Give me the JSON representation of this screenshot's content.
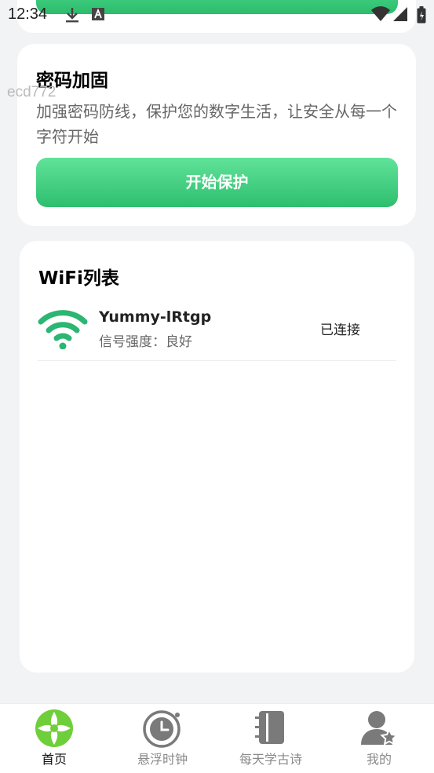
{
  "status_bar": {
    "time": "12:34"
  },
  "password_card": {
    "title": "密码加固",
    "description": "加强密码防线，保护您的数字生活，让安全从每一个字符开始",
    "button_label": "开始保护"
  },
  "watermark": "ecd772",
  "wifi_card": {
    "title": "WiFi列表",
    "items": [
      {
        "name": "Yummy-lRtgp",
        "signal": "信号强度：良好",
        "status": "已连接"
      }
    ]
  },
  "bottom_nav": {
    "items": [
      {
        "label": "首页",
        "icon": "home-logo-icon",
        "active": true
      },
      {
        "label": "悬浮时钟",
        "icon": "clock-icon",
        "active": false
      },
      {
        "label": "每天学古诗",
        "icon": "book-icon",
        "active": false
      },
      {
        "label": "我的",
        "icon": "user-icon",
        "active": false
      }
    ]
  },
  "colors": {
    "accent": "#2ebe6e",
    "wifi_icon": "#2bb673",
    "background": "#f2f3f5"
  }
}
